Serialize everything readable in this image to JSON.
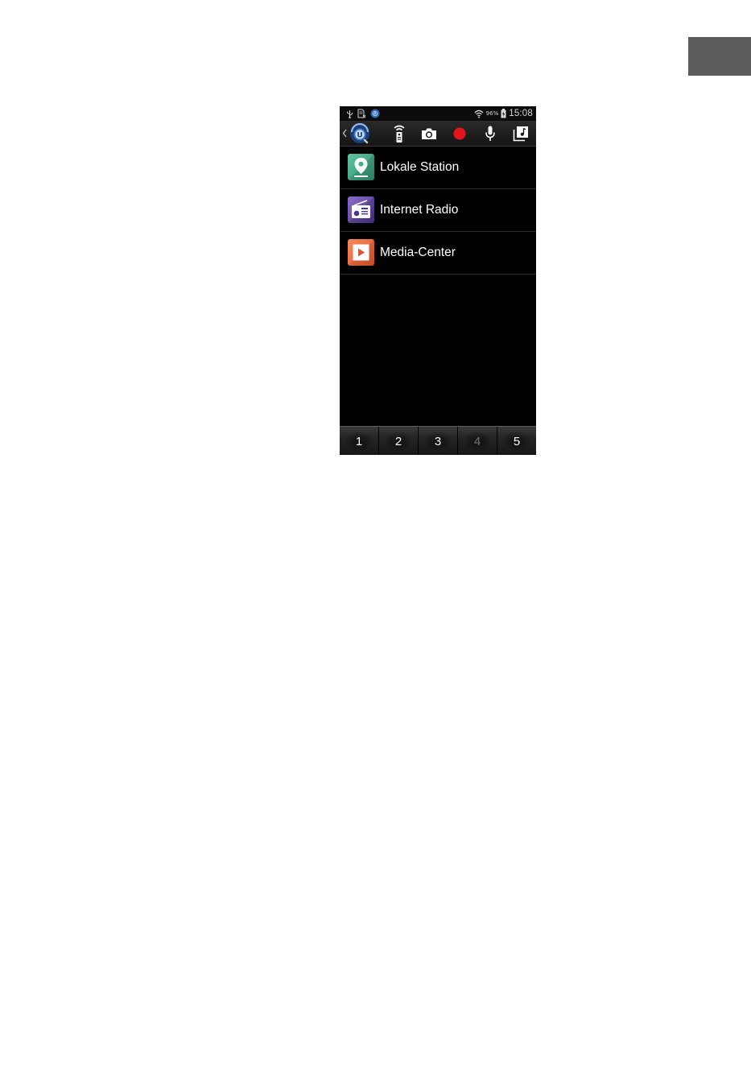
{
  "status_bar": {
    "battery_percent": "96%",
    "time": "15:08",
    "icons": [
      "usb-icon",
      "sd-card-icon",
      "app-notification-icon",
      "wifi-icon",
      "battery-charging-icon"
    ]
  },
  "toolbar": {
    "buttons": [
      "back-icon",
      "app-logo-icon",
      "remote-control-icon",
      "camera-icon",
      "record-icon",
      "microphone-icon",
      "music-library-icon"
    ],
    "record_color": "#e8141b"
  },
  "menu": {
    "items": [
      {
        "label": "Lokale Station",
        "icon": "location-pin-icon",
        "color": "#3fae8c"
      },
      {
        "label": "Internet Radio",
        "icon": "radio-icon",
        "color": "#6a4fa8"
      },
      {
        "label": "Media-Center",
        "icon": "play-icon",
        "color": "#ef6b3a"
      }
    ]
  },
  "pager": {
    "pages": [
      "1",
      "2",
      "3",
      "4",
      "5"
    ],
    "dimmed_page": "4"
  }
}
